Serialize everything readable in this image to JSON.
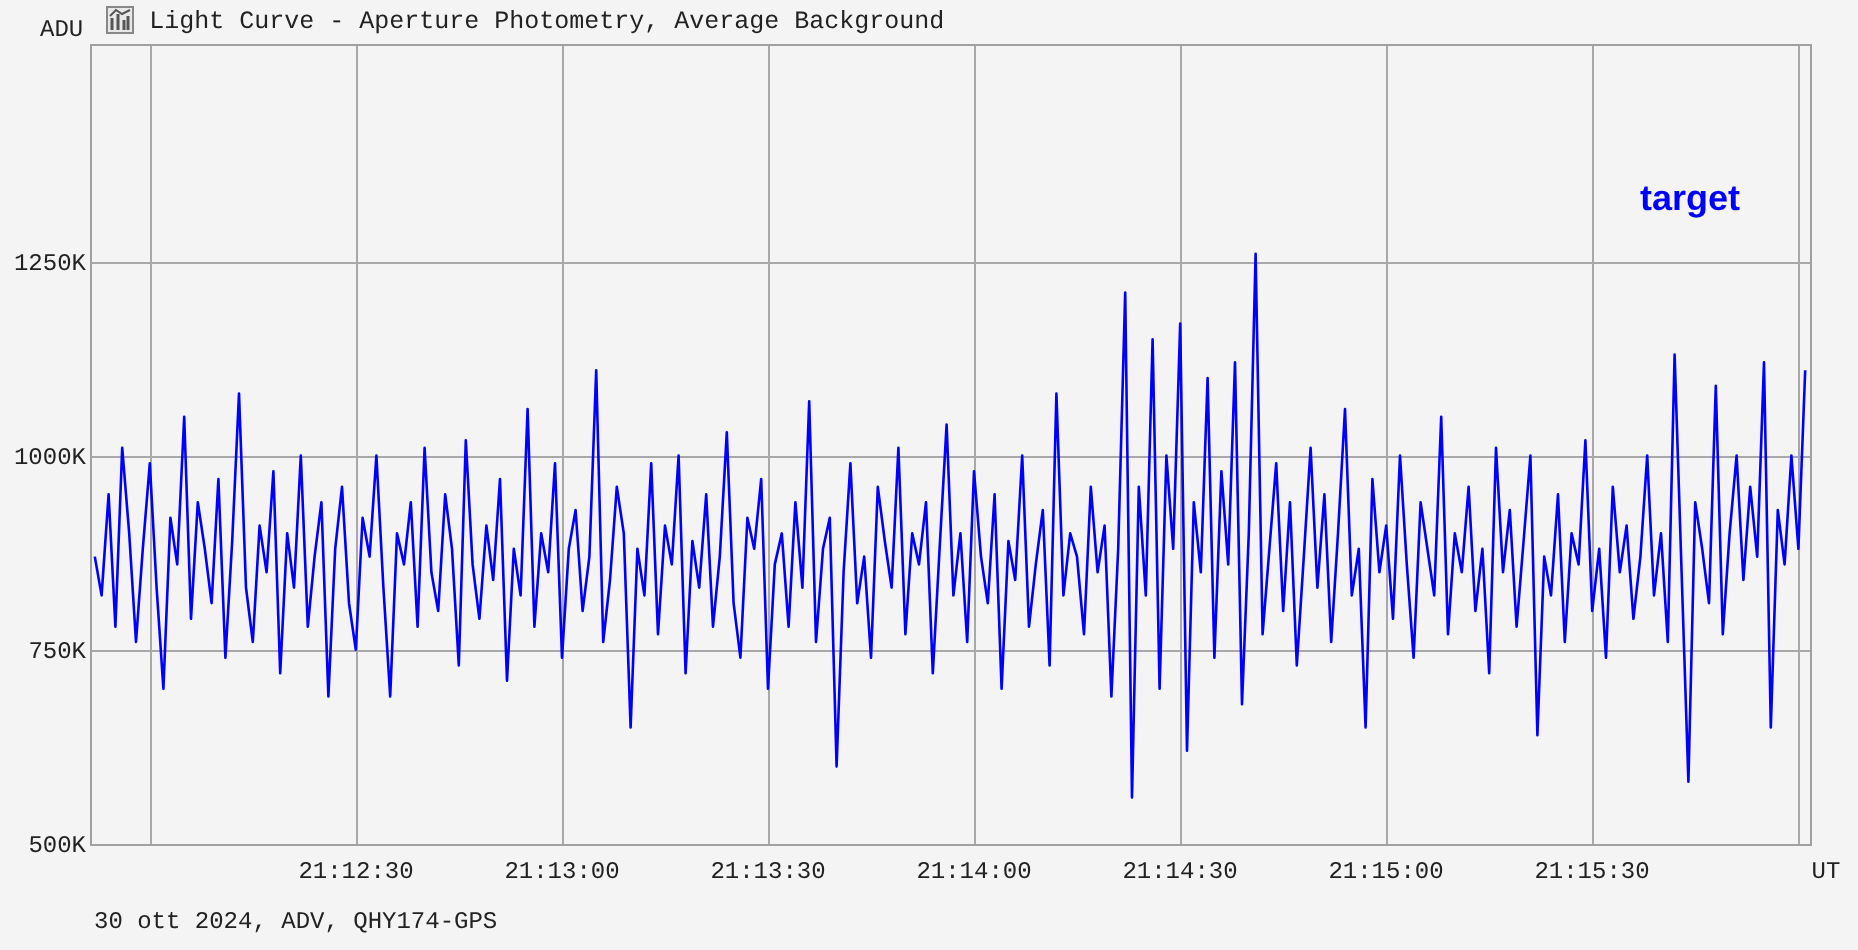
{
  "window": {
    "title": "Light Curve - Aperture Photometry, Average Background"
  },
  "chart": {
    "chart_data": {
      "type": "line",
      "xlabel": "UT",
      "ylabel": "ADU",
      "grid": true,
      "ylim": [
        500,
        1530
      ],
      "categories": [
        null,
        null,
        null,
        null,
        null,
        null,
        null,
        null,
        null,
        null,
        null,
        null,
        null,
        null,
        null,
        null,
        null,
        null,
        null,
        null,
        null,
        null,
        null,
        null,
        null,
        null,
        null,
        null,
        null,
        null,
        null,
        null,
        null,
        null,
        null,
        null,
        null,
        null,
        "21:12:30",
        null,
        null,
        null,
        null,
        null,
        null,
        null,
        null,
        null,
        null,
        null,
        null,
        null,
        null,
        null,
        null,
        null,
        null,
        null,
        null,
        null,
        null,
        null,
        null,
        null,
        null,
        null,
        null,
        null,
        "21:13:00",
        null,
        null,
        null,
        null,
        null,
        null,
        null,
        null,
        null,
        null,
        null,
        null,
        null,
        null,
        null,
        null,
        null,
        null,
        null,
        null,
        null,
        null,
        null,
        null,
        null,
        null,
        null,
        null,
        null,
        "21:13:30",
        null,
        null,
        null,
        null,
        null,
        null,
        null,
        null,
        null,
        null,
        null,
        null,
        null,
        null,
        null,
        null,
        null,
        null,
        null,
        null,
        null,
        null,
        null,
        null,
        null,
        null,
        null,
        null,
        null,
        "21:14:00",
        null,
        null,
        null,
        null,
        null,
        null,
        null,
        null,
        null,
        null,
        null,
        null,
        null,
        null,
        null,
        null,
        null,
        null,
        null,
        null,
        null,
        null,
        null,
        null,
        null,
        null,
        null,
        null,
        null,
        "21:14:30",
        null,
        null,
        null,
        null,
        null,
        null,
        null,
        null,
        null,
        null,
        null,
        null,
        null,
        null,
        null,
        null,
        null,
        null,
        null,
        null,
        null,
        null,
        null,
        null,
        null,
        null,
        null,
        null,
        null,
        "21:15:00",
        null,
        null,
        null,
        null,
        null,
        null,
        null,
        null,
        null,
        null,
        null,
        null,
        null,
        null,
        null,
        null,
        null,
        null,
        null,
        null,
        null,
        null,
        null,
        null,
        null,
        null,
        null,
        null,
        null,
        "21:15:30",
        null,
        null,
        null,
        null,
        null,
        null,
        null,
        null,
        null,
        null,
        null,
        null,
        null,
        null,
        null,
        null,
        null,
        null,
        null,
        null,
        null,
        null,
        null,
        null,
        null,
        null,
        null,
        null,
        null,
        null,
        null
      ],
      "yticks": [
        {
          "value": 1250,
          "label": "1250K"
        },
        {
          "value": 1000,
          "label": "1000K"
        },
        {
          "value": 750,
          "label": "750K"
        },
        {
          "value": 500,
          "label": "500K"
        }
      ],
      "series": [
        {
          "name": "target",
          "color": "#0000ff",
          "values": [
            870,
            820,
            950,
            780,
            1010,
            900,
            760,
            880,
            990,
            830,
            700,
            920,
            860,
            1050,
            790,
            940,
            880,
            810,
            970,
            740,
            890,
            1080,
            830,
            760,
            910,
            850,
            980,
            720,
            900,
            830,
            1000,
            780,
            870,
            940,
            690,
            880,
            960,
            810,
            750,
            920,
            870,
            1000,
            830,
            690,
            900,
            860,
            940,
            780,
            1010,
            850,
            800,
            950,
            880,
            730,
            1020,
            860,
            790,
            910,
            840,
            970,
            710,
            880,
            820,
            1060,
            780,
            900,
            850,
            990,
            740,
            880,
            930,
            800,
            870,
            1110,
            760,
            840,
            960,
            900,
            650,
            880,
            820,
            990,
            770,
            910,
            860,
            1000,
            720,
            890,
            830,
            950,
            780,
            870,
            1030,
            810,
            740,
            920,
            880,
            970,
            700,
            860,
            900,
            780,
            940,
            830,
            1070,
            760,
            880,
            920,
            600,
            850,
            990,
            810,
            870,
            740,
            960,
            890,
            830,
            1010,
            770,
            900,
            860,
            940,
            720,
            880,
            1040,
            820,
            900,
            760,
            980,
            870,
            810,
            950,
            700,
            890,
            840,
            1000,
            780,
            860,
            930,
            730,
            1080,
            820,
            900,
            870,
            770,
            960,
            850,
            910,
            690,
            880,
            1210,
            560,
            960,
            820,
            1150,
            700,
            1000,
            880,
            1170,
            620,
            940,
            850,
            1100,
            740,
            980,
            860,
            1120,
            680,
            900,
            1260,
            770,
            880,
            990,
            800,
            940,
            730,
            870,
            1010,
            830,
            950,
            760,
            900,
            1060,
            820,
            880,
            650,
            970,
            850,
            910,
            790,
            1000,
            860,
            740,
            940,
            880,
            820,
            1050,
            770,
            900,
            850,
            960,
            800,
            880,
            720,
            1010,
            850,
            930,
            780,
            890,
            1000,
            640,
            870,
            820,
            950,
            760,
            900,
            860,
            1020,
            800,
            880,
            740,
            960,
            850,
            910,
            790,
            870,
            1000,
            820,
            900,
            760,
            1130,
            850,
            580,
            940,
            880,
            810,
            1090,
            770,
            900,
            1000,
            840,
            960,
            870,
            1120,
            650,
            930,
            860,
            1000,
            880,
            1110
          ]
        }
      ]
    }
  },
  "footer": "30 ott 2024, ADV, QHY174-GPS"
}
